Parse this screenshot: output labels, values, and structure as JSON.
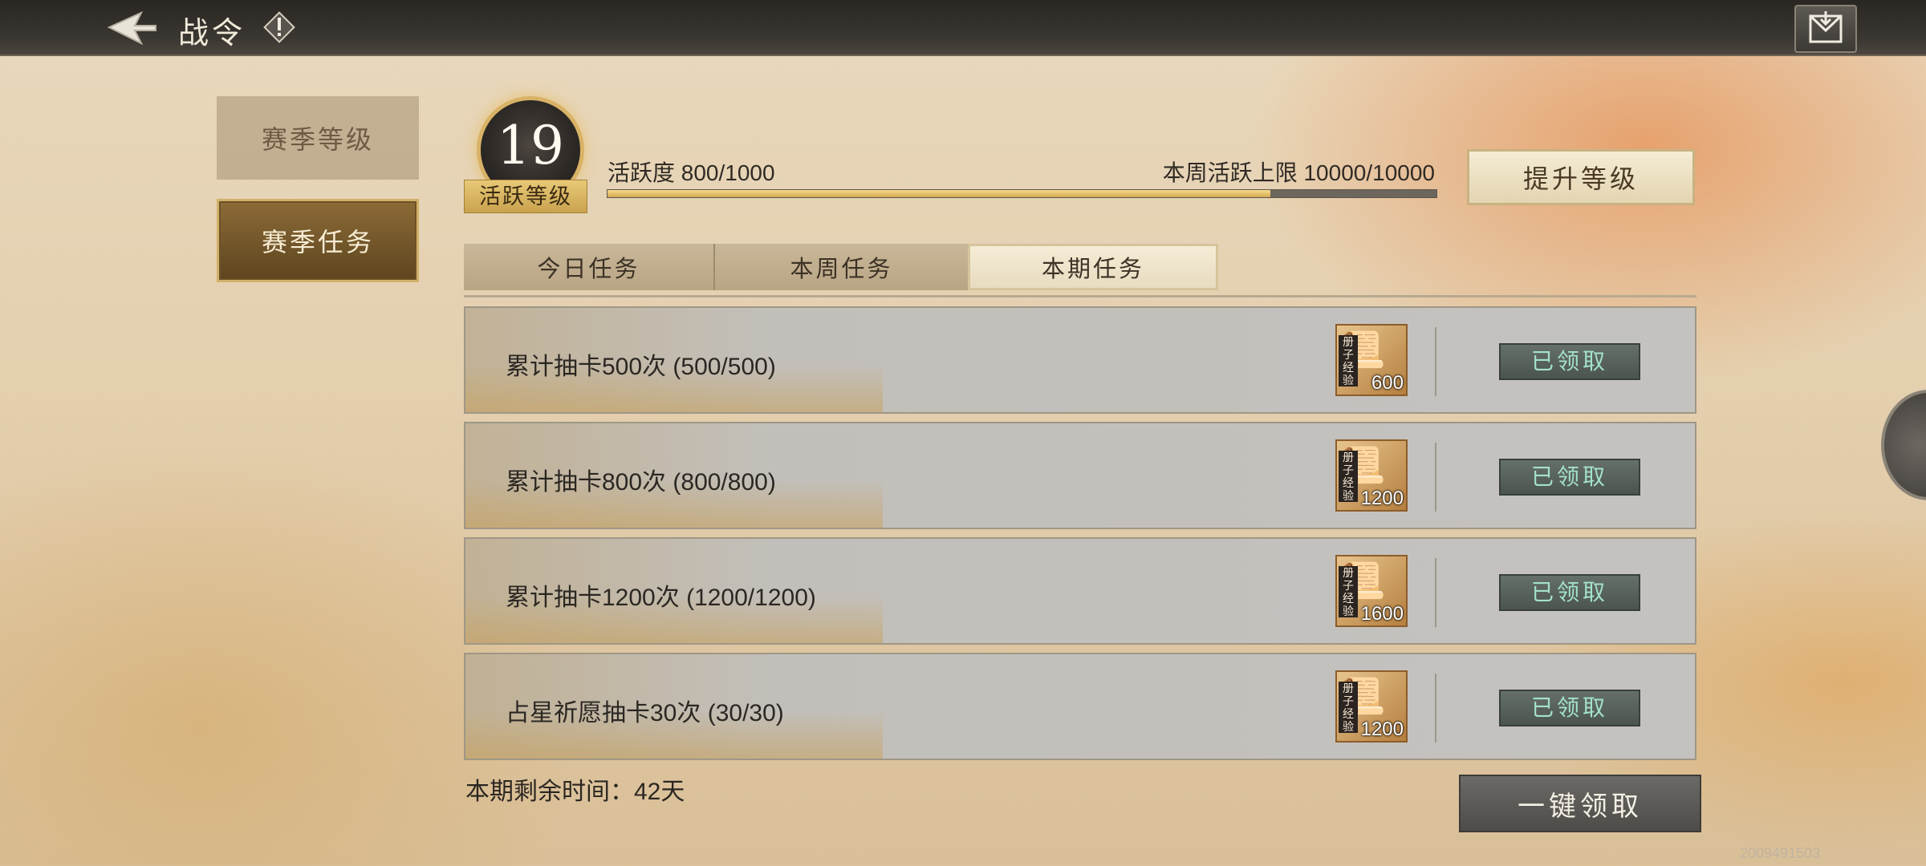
{
  "header": {
    "title": "战令",
    "icons": {
      "back": "back-arrow-icon",
      "info": "info-icon",
      "mail": "mail-icon"
    }
  },
  "nav": {
    "season_level": "赛季等级",
    "season_tasks": "赛季任务"
  },
  "level": {
    "number": "19",
    "label": "活跃等级"
  },
  "activity": {
    "text": "活跃度 800/1000",
    "weekly_limit": "本周活跃上限 10000/10000",
    "progress": 0.8
  },
  "upgrade_button": "提升等级",
  "tabs": [
    {
      "label": "今日任务",
      "active": false
    },
    {
      "label": "本周任务",
      "active": false
    },
    {
      "label": "本期任务",
      "active": true
    }
  ],
  "tasks": [
    {
      "name": "累计抽卡500次 (500/500)",
      "reward_tag": "册子经验",
      "reward_count": "600",
      "status": "已领取"
    },
    {
      "name": "累计抽卡800次 (800/800)",
      "reward_tag": "册子经验",
      "reward_count": "1200",
      "status": "已领取"
    },
    {
      "name": "累计抽卡1200次 (1200/1200)",
      "reward_tag": "册子经验",
      "reward_count": "1600",
      "status": "已领取"
    },
    {
      "name": "占星祈愿抽卡30次 (30/30)",
      "reward_tag": "册子经验",
      "reward_count": "1200",
      "status": "已领取"
    }
  ],
  "remaining_time": "本期剩余时间：42天",
  "claim_all_button": "一键领取",
  "id_text": "2009491503",
  "colors": {
    "gold": "#d8b266",
    "claimed_text": "#a3e2c9",
    "background": "#e4cfae"
  }
}
